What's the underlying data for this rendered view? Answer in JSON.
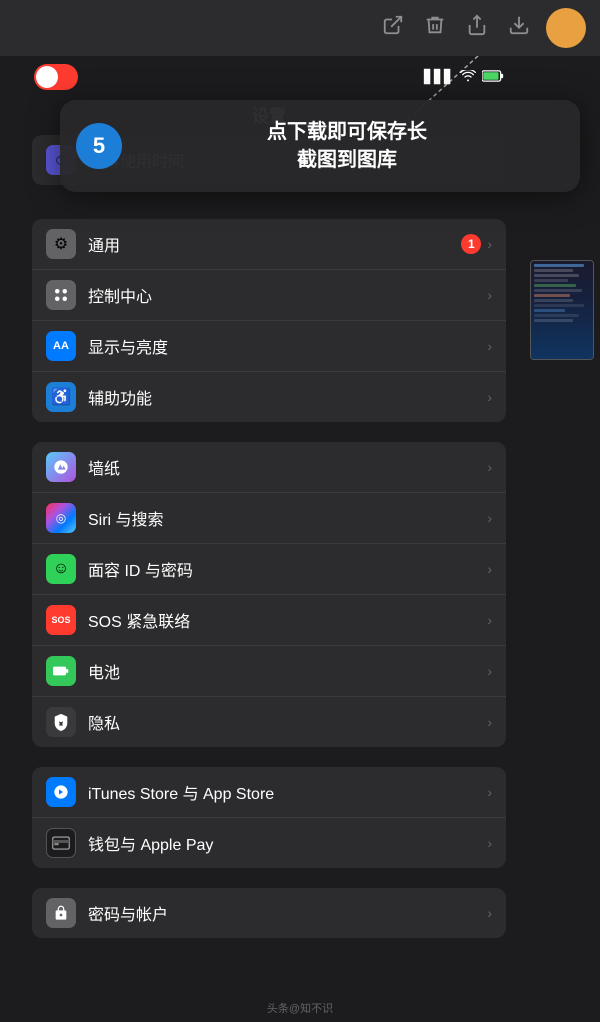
{
  "toolbar": {
    "icons": [
      "export-icon",
      "trash-icon",
      "share-icon",
      "download-icon"
    ]
  },
  "statusBar": {
    "signal": "▋▋▋",
    "wifi": "WiFi",
    "battery": "🔋"
  },
  "settings": {
    "title": "设置",
    "groups": [
      {
        "id": "group1",
        "items": [
          {
            "id": "screen-time",
            "label": "屏幕使用时间",
            "iconBg": "bg-indigo",
            "iconChar": "⏱",
            "badge": "",
            "chevron": true
          }
        ]
      },
      {
        "id": "group2",
        "items": [
          {
            "id": "general",
            "label": "通用",
            "iconBg": "bg-gray",
            "iconChar": "⚙️",
            "badge": "1",
            "chevron": true
          },
          {
            "id": "control",
            "label": "控制中心",
            "iconBg": "bg-gray",
            "iconChar": "☰",
            "badge": "",
            "chevron": true
          },
          {
            "id": "display",
            "label": "显示与亮度",
            "iconBg": "bg-blue",
            "iconChar": "AA",
            "badge": "",
            "chevron": true
          },
          {
            "id": "accessibility",
            "label": "辅助功能",
            "iconBg": "bg-blue",
            "iconChar": "♿",
            "badge": "",
            "chevron": true
          }
        ]
      },
      {
        "id": "group3",
        "items": [
          {
            "id": "wallpaper",
            "label": "墙纸",
            "iconBg": "bg-teal",
            "iconChar": "✿",
            "badge": "",
            "chevron": true
          },
          {
            "id": "siri",
            "label": "Siri 与搜索",
            "iconBg": "bg-dark",
            "iconChar": "◈",
            "badge": "",
            "chevron": true
          },
          {
            "id": "faceid",
            "label": "面容 ID 与密码",
            "iconBg": "bg-green2",
            "iconChar": "☺",
            "badge": "",
            "chevron": true
          },
          {
            "id": "sos",
            "label": "SOS 紧急联络",
            "iconBg": "bg-red",
            "iconChar": "SOS",
            "badge": "",
            "chevron": true
          },
          {
            "id": "battery",
            "label": "电池",
            "iconBg": "bg-green",
            "iconChar": "—",
            "badge": "",
            "chevron": true
          },
          {
            "id": "privacy",
            "label": "隐私",
            "iconBg": "bg-blue",
            "iconChar": "✋",
            "badge": "",
            "chevron": true
          }
        ]
      },
      {
        "id": "group4",
        "items": [
          {
            "id": "itunes",
            "label": "iTunes Store 与 App Store",
            "iconBg": "bg-appstore",
            "iconChar": "A",
            "badge": "",
            "chevron": true
          },
          {
            "id": "wallet",
            "label": "钱包与 Apple Pay",
            "iconBg": "bg-wallet",
            "iconChar": "💳",
            "badge": "",
            "chevron": true
          }
        ]
      },
      {
        "id": "group5",
        "items": [
          {
            "id": "passwords",
            "label": "密码与帐户",
            "iconBg": "bg-gray",
            "iconChar": "🔑",
            "badge": "",
            "chevron": true
          }
        ]
      }
    ]
  },
  "callout": {
    "number": "5",
    "text": "点下载即可保存长\n截图到图库"
  },
  "watermark": "头条@知不识"
}
